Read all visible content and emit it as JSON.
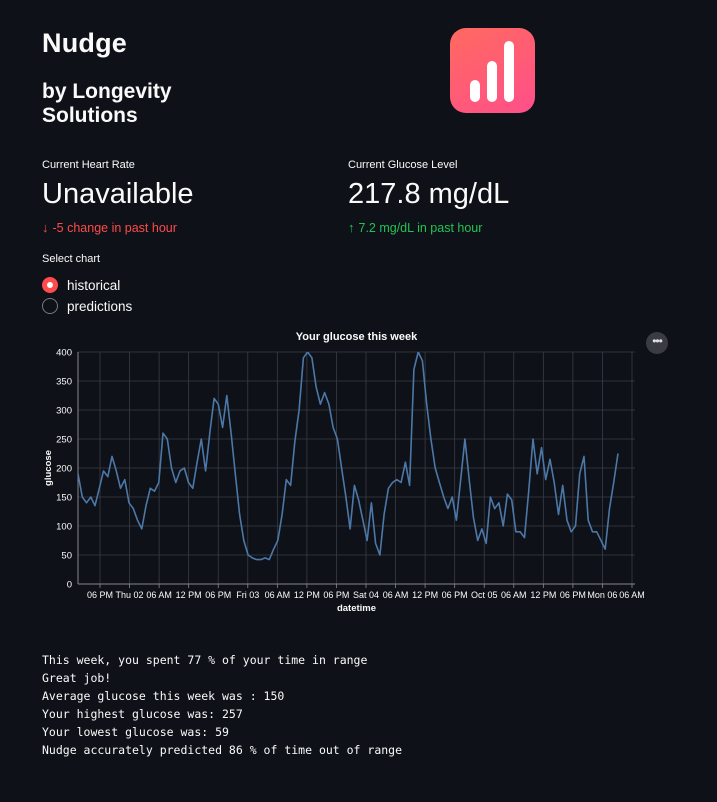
{
  "header": {
    "title": "Nudge",
    "subtitle": "by Longevity Solutions"
  },
  "metrics": {
    "heart_rate": {
      "label": "Current Heart Rate",
      "value": "Unavailable",
      "delta": "-5 change in past hour",
      "direction": "down",
      "color": "#ff4b4b"
    },
    "glucose": {
      "label": "Current Glucose Level",
      "value": "217.8 mg/dL",
      "delta": "7.2 mg/dL in past hour",
      "direction": "up",
      "color": "#21c354"
    }
  },
  "chart_selector": {
    "label": "Select chart",
    "options": [
      "historical",
      "predictions"
    ],
    "selected": "historical"
  },
  "chart_data": {
    "type": "line",
    "title": "Your glucose this week",
    "xlabel": "datetime",
    "ylabel": "glucose",
    "ylim": [
      0,
      400
    ],
    "yticks": [
      0,
      50,
      100,
      150,
      200,
      250,
      300,
      350,
      400
    ],
    "xticks": [
      "06 PM",
      "Thu 02",
      "06 AM",
      "12 PM",
      "06 PM",
      "Fri 03",
      "06 AM",
      "12 PM",
      "06 PM",
      "Sat 04",
      "06 AM",
      "12 PM",
      "06 PM",
      "Oct 05",
      "06 AM",
      "12 PM",
      "06 PM",
      "Mon 06",
      "06 AM"
    ],
    "grid": true,
    "series": [
      {
        "color": "#4c78a8",
        "x_hours": [
          0,
          1,
          2,
          3,
          4,
          5,
          6,
          7,
          8,
          9,
          10,
          11,
          12,
          13,
          14,
          15,
          16,
          17,
          18,
          19,
          20,
          21,
          22,
          23,
          24,
          25,
          26,
          27,
          28,
          29,
          30,
          31,
          32,
          33,
          34,
          35,
          36,
          37,
          38,
          39,
          40,
          41,
          42,
          43,
          44,
          45,
          46,
          47,
          48,
          49,
          50,
          51,
          52,
          53,
          54,
          55,
          56,
          57,
          58,
          59,
          60,
          61,
          62,
          63,
          64,
          65,
          66,
          67,
          68,
          69,
          70,
          71,
          72,
          73,
          74,
          75,
          76,
          77,
          78,
          79,
          80,
          81,
          82,
          83,
          84,
          85,
          86,
          87,
          88,
          89,
          90,
          91,
          92,
          93,
          94,
          95,
          96,
          97,
          98,
          99,
          100,
          101,
          102,
          103,
          104,
          105,
          106,
          107,
          108,
          109,
          110,
          111,
          112,
          113,
          114,
          115,
          116,
          117,
          118,
          119,
          120,
          121,
          122,
          123,
          124,
          125,
          126,
          127,
          128,
          129,
          130,
          131
        ],
        "values": [
          190,
          150,
          140,
          150,
          135,
          165,
          195,
          185,
          220,
          195,
          165,
          180,
          140,
          130,
          110,
          95,
          135,
          165,
          160,
          175,
          260,
          250,
          200,
          175,
          195,
          200,
          175,
          165,
          210,
          250,
          195,
          260,
          320,
          310,
          270,
          325,
          260,
          190,
          120,
          75,
          50,
          45,
          42,
          42,
          45,
          42,
          60,
          75,
          120,
          180,
          170,
          245,
          300,
          390,
          400,
          390,
          340,
          310,
          330,
          310,
          270,
          250,
          200,
          150,
          95,
          170,
          145,
          110,
          75,
          140,
          70,
          50,
          120,
          165,
          175,
          180,
          175,
          210,
          170,
          370,
          400,
          385,
          310,
          250,
          200,
          175,
          150,
          130,
          150,
          110,
          180,
          250,
          180,
          115,
          75,
          95,
          70,
          150,
          130,
          140,
          100,
          155,
          145,
          90,
          90,
          80,
          160,
          250,
          190,
          235,
          180,
          215,
          175,
          120,
          170,
          110,
          90,
          100,
          190,
          220,
          110,
          90,
          90,
          75,
          60,
          130,
          175,
          225
        ]
      }
    ]
  },
  "stats": {
    "line1": "This week, you spent 77 % of your time in range",
    "line2": "Great job!",
    "line3": "Average glucose this week was : 150",
    "line4": "Your highest glucose was: 257",
    "line5": "Your lowest glucose was: 59",
    "line6": "Nudge accurately predicted 86 % of time out of range"
  }
}
